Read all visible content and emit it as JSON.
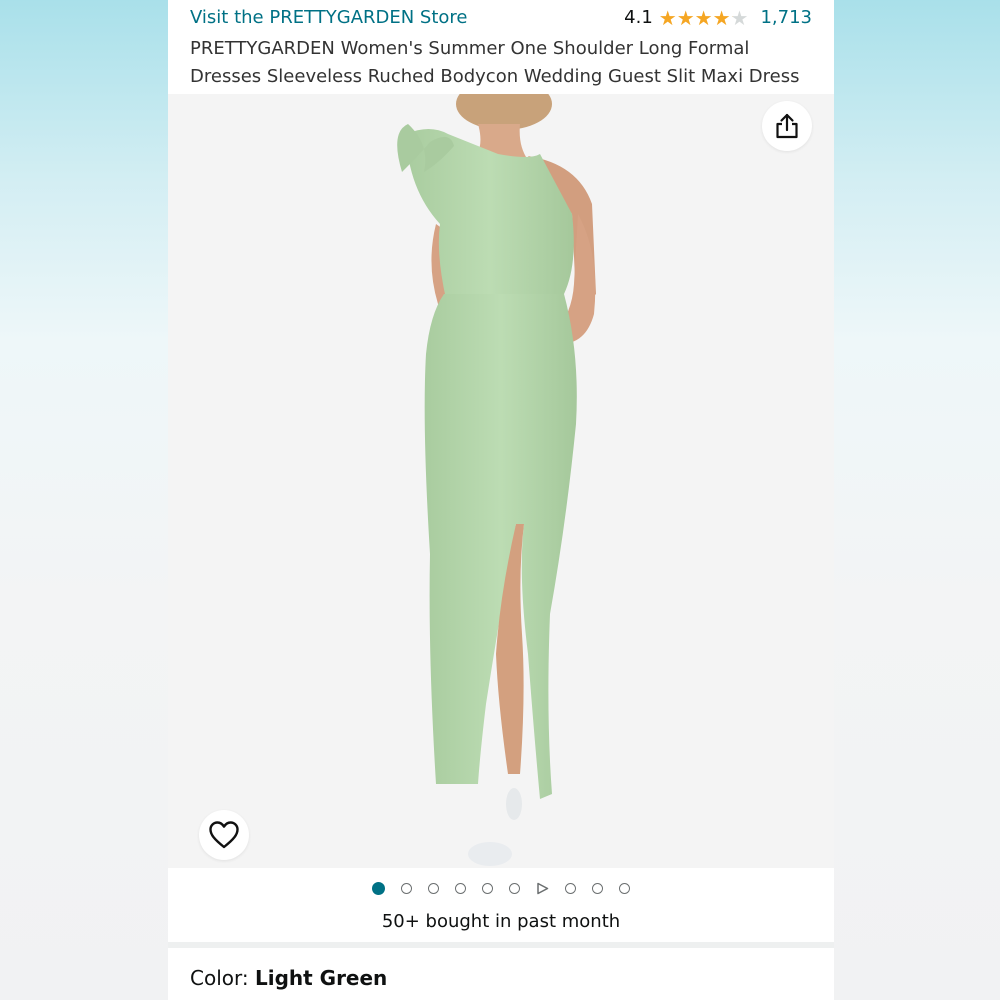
{
  "header": {
    "store_link": "Visit the PRETTYGARDEN Store",
    "rating_value": "4.1",
    "rating_stars": 4.1,
    "review_count": "1,713",
    "product_title": "PRETTYGARDEN Women's Summer One Shoulder Long Formal Dresses Sleeveless Ruched Bodycon Wedding Guest Slit Maxi Dress"
  },
  "image": {
    "description_icon": "product-photo",
    "share_icon": "share-icon",
    "wishlist_icon": "heart-icon"
  },
  "carousel": {
    "total_items": 10,
    "active_index": 0,
    "video_index": 6
  },
  "social_proof": {
    "bought_text": "50+ bought in past month"
  },
  "variation": {
    "color_label": "Color:",
    "color_value": "Light Green"
  },
  "colors": {
    "link": "#007185",
    "star": "#f5a623",
    "dress": "#b5d6ad"
  }
}
